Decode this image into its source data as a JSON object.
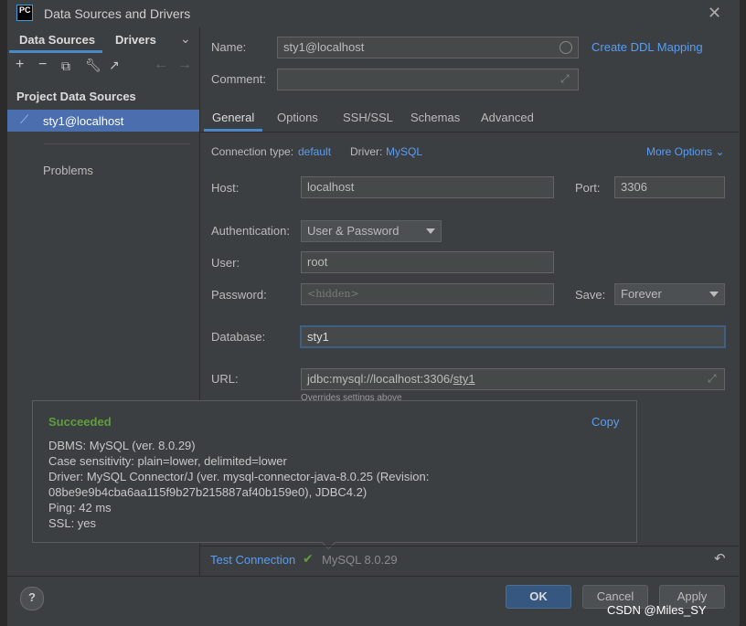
{
  "window": {
    "title": "Data Sources and Drivers",
    "logo_text": "PC"
  },
  "sidebar": {
    "tabs": [
      "Data Sources",
      "Drivers"
    ],
    "section": "Project Data Sources",
    "items": [
      {
        "label": "sty1@localhost",
        "selected": true
      }
    ],
    "problems": "Problems"
  },
  "form": {
    "name_label": "Name:",
    "name_value": "sty1@localhost",
    "create_ddl": "Create DDL Mapping",
    "comment_label": "Comment:",
    "comment_value": "",
    "tabs": [
      "General",
      "Options",
      "SSH/SSL",
      "Schemas",
      "Advanced"
    ],
    "active_tab": "General",
    "conn_type_label": "Connection type:",
    "conn_type_value": "default",
    "driver_label": "Driver:",
    "driver_value": "MySQL",
    "more_options": "More Options",
    "host_label": "Host:",
    "host_value": "localhost",
    "port_label": "Port:",
    "port_value": "3306",
    "auth_label": "Authentication:",
    "auth_value": "User & Password",
    "user_label": "User:",
    "user_value": "root",
    "password_label": "Password:",
    "password_placeholder": "<hidden>",
    "save_label": "Save:",
    "save_value": "Forever",
    "database_label": "Database:",
    "database_value": "sty1",
    "url_label": "URL:",
    "url_prefix": "jdbc:mysql://localhost:3306/",
    "url_db": "sty1",
    "url_hint": "Overrides settings above"
  },
  "popup": {
    "status": "Succeeded",
    "copy": "Copy",
    "lines": [
      "DBMS: MySQL (ver. 8.0.29)",
      "Case sensitivity: plain=lower, delimited=lower",
      "Driver: MySQL Connector/J (ver. mysql-connector-java-8.0.25 (Revision:",
      "08be9e9b4cba6aa115f9b27b215887af40b159e0), JDBC4.2)",
      "Ping: 42 ms",
      "SSL: yes"
    ]
  },
  "test": {
    "link": "Test Connection",
    "result": "MySQL 8.0.29"
  },
  "buttons": {
    "help": "?",
    "ok": "OK",
    "cancel": "Cancel",
    "apply": "Apply"
  },
  "watermark": "CSDN @Miles_SY",
  "colors": {
    "accent": "#589df6",
    "success": "#5f9e3c",
    "selection": "#4b6eaf"
  }
}
